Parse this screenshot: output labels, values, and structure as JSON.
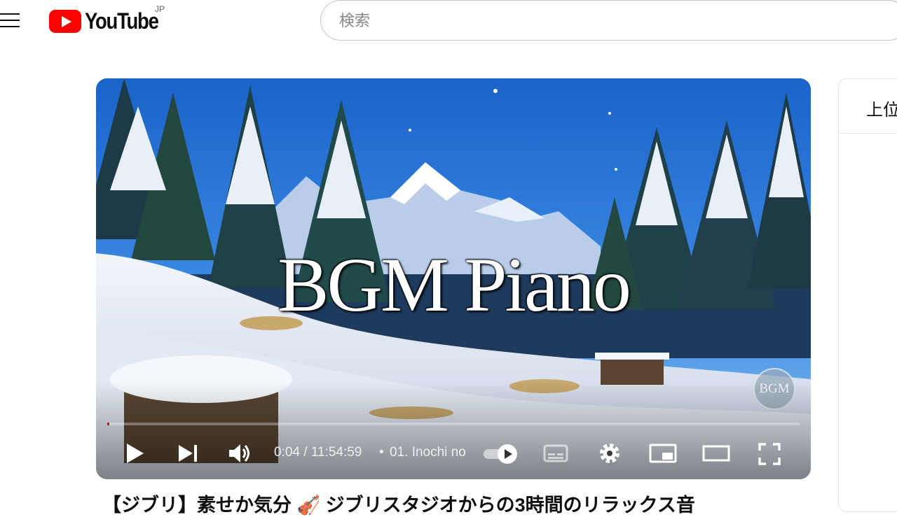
{
  "header": {
    "logo_text": "YouTube",
    "country_code": "JP",
    "search_placeholder": "検索",
    "brand_color": "#ff0000"
  },
  "player": {
    "overlay_title": "BGM Piano",
    "watermark_text": "BGM",
    "current_time": "0:04",
    "duration": "11:54:59",
    "time_display": "0:04 / 11:54:59",
    "chapter_separator": "•",
    "chapter_label": "01. Inochi no",
    "progress_fraction": 0.0001,
    "icons": [
      "play-icon",
      "next-icon",
      "volume-icon",
      "autoplay-toggle-icon",
      "subtitles-icon",
      "settings-icon",
      "miniplayer-icon",
      "theater-mode-icon",
      "fullscreen-icon"
    ]
  },
  "side_panel": {
    "tab_label": "上位"
  },
  "video": {
    "title": "【ジブリ】素せか気分 🎻 ジブリスタジオからの3時間のリラックス音"
  }
}
